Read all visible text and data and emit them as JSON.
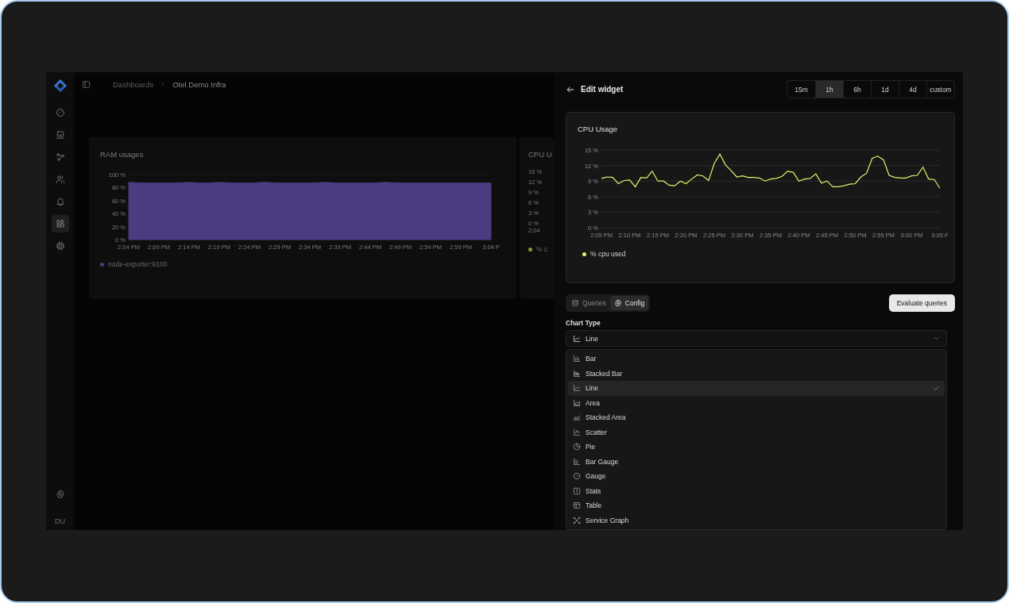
{
  "sidebar": {
    "items": [
      {
        "selected": false
      },
      {
        "selected": false
      },
      {
        "selected": false
      },
      {
        "selected": false
      },
      {
        "selected": false
      },
      {
        "selected": true
      },
      {
        "selected": false
      }
    ],
    "avatar": "DU"
  },
  "breadcrumb": [
    "Dashboards",
    "Otel Demo Infra"
  ],
  "dashboard": {
    "panels": [
      {
        "title": "RAM usages",
        "chart_data": {
          "type": "area",
          "grid": true,
          "ylim": [
            0,
            100
          ],
          "yticks": [
            {
              "value": 0,
              "label": "0 %"
            },
            {
              "value": 20,
              "label": "20 %"
            },
            {
              "value": 40,
              "label": "40 %"
            },
            {
              "value": 60,
              "label": "60 %"
            },
            {
              "value": 80,
              "label": "80 %"
            },
            {
              "value": 100,
              "label": "100 %"
            }
          ],
          "categories": [
            "2:04 PM",
            null,
            "2:09 PM",
            null,
            "2:14 PM",
            null,
            "2:19 PM",
            null,
            "2:24 PM",
            null,
            "2:29 PM",
            null,
            "2:34 PM",
            null,
            "2:39 PM",
            null,
            "2:44 PM",
            null,
            "2:49 PM",
            null,
            "2:54 PM",
            null,
            "2:59 PM",
            null,
            "3:04 P"
          ],
          "series": [
            {
              "name": "node-exporter:9100",
              "color": "#4b3b80",
              "values": [
                88,
                87,
                87,
                87,
                88,
                87,
                88,
                87,
                87,
                88,
                87,
                87,
                87,
                88,
                87,
                87,
                87,
                88,
                87,
                87,
                87,
                87,
                87,
                87,
                87
              ]
            }
          ]
        }
      },
      {
        "title": "CPU U",
        "y_labels": [
          "15 %",
          "12 %",
          "9 %",
          "6 %",
          "3 %",
          "0 %"
        ],
        "x_label": "2:04",
        "legend": {
          "name": "% c",
          "color": "#8f9a2a"
        }
      }
    ]
  },
  "editor": {
    "title": "Edit widget",
    "time_ranges": [
      {
        "label": "15m",
        "selected": false
      },
      {
        "label": "1h",
        "selected": true
      },
      {
        "label": "6h",
        "selected": false
      },
      {
        "label": "1d",
        "selected": false
      },
      {
        "label": "4d",
        "selected": false
      },
      {
        "label": "custom",
        "selected": false
      }
    ],
    "preview": {
      "title": "CPU Usage",
      "chart_data": {
        "type": "line",
        "grid": true,
        "ylim": [
          0,
          15
        ],
        "yticks": [
          {
            "value": 0,
            "label": "0 %"
          },
          {
            "value": 3,
            "label": "3 %"
          },
          {
            "value": 6,
            "label": "6 %"
          },
          {
            "value": 9,
            "label": "9 %"
          },
          {
            "value": 12,
            "label": "12 %"
          },
          {
            "value": 15,
            "label": "15 %"
          }
        ],
        "categories": [
          "2:05 PM",
          null,
          null,
          null,
          null,
          "2:10 PM",
          null,
          null,
          null,
          null,
          "2:15 PM",
          null,
          null,
          null,
          null,
          "2:20 PM",
          null,
          null,
          null,
          null,
          "2:25 PM",
          null,
          null,
          null,
          null,
          "2:30 PM",
          null,
          null,
          null,
          null,
          "2:35 PM",
          null,
          null,
          null,
          null,
          "2:40 PM",
          null,
          null,
          null,
          null,
          "2:45 PM",
          null,
          null,
          null,
          null,
          "2:50 PM",
          null,
          null,
          null,
          null,
          "2:55 PM",
          null,
          null,
          null,
          null,
          "3:00 PM",
          null,
          null,
          null,
          null,
          "3:05 F"
        ],
        "series": [
          {
            "name": "% cpu used",
            "color": "#e6f26a",
            "values": [
              9.5,
              9.8,
              9.7,
              8.5,
              9.1,
              9.2,
              7.9,
              9.7,
              9.6,
              10.9,
              9.0,
              9.0,
              8.2,
              8.1,
              9.0,
              8.5,
              9.4,
              10.2,
              10.0,
              9.1,
              12.4,
              14.2,
              12.1,
              11.0,
              9.8,
              10.0,
              9.7,
              9.7,
              9.6,
              9.0,
              9.4,
              9.5,
              9.9,
              10.9,
              10.7,
              9.0,
              9.4,
              9.5,
              10.4,
              8.6,
              9.0,
              7.9,
              7.9,
              8.1,
              8.4,
              8.5,
              9.8,
              10.5,
              13.4,
              13.8,
              13.1,
              10.1,
              9.7,
              9.6,
              9.6,
              10.0,
              10.1,
              11.7,
              9.4,
              9.3,
              7.6
            ]
          }
        ]
      }
    },
    "tabs": [
      {
        "label": "Queries",
        "selected": false
      },
      {
        "label": "Config",
        "selected": true
      }
    ],
    "evaluate_button": "Evaluate queries",
    "chart_type": {
      "label": "Chart Type",
      "value": "Line",
      "options": [
        {
          "label": "Bar",
          "selected": false
        },
        {
          "label": "Stacked Bar",
          "selected": false
        },
        {
          "label": "Line",
          "selected": true
        },
        {
          "label": "Area",
          "selected": false
        },
        {
          "label": "Stacked Area",
          "selected": false
        },
        {
          "label": "Scatter",
          "selected": false
        },
        {
          "label": "Pie",
          "selected": false
        },
        {
          "label": "Bar Gauge",
          "selected": false
        },
        {
          "label": "Gauge",
          "selected": false
        },
        {
          "label": "Stats",
          "selected": false
        },
        {
          "label": "Table",
          "selected": false
        },
        {
          "label": "Service Graph",
          "selected": false
        }
      ]
    }
  }
}
